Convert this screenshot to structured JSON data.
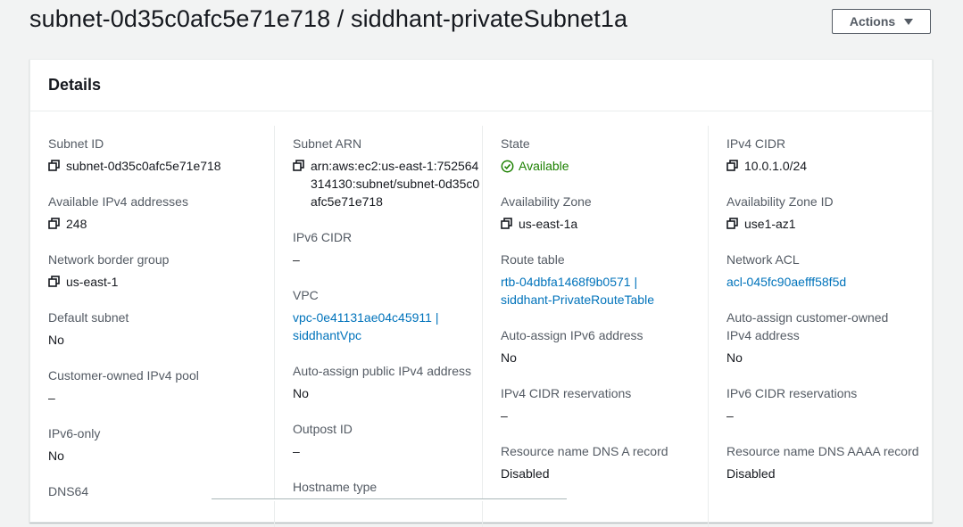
{
  "header": {
    "title": "subnet-0d35c0afc5e71e718 / siddhant-privateSubnet1a",
    "actions_label": "Actions"
  },
  "panel": {
    "title": "Details"
  },
  "col1": {
    "subnet_id": {
      "label": "Subnet ID",
      "value": "subnet-0d35c0afc5e71e718"
    },
    "available_ipv4": {
      "label": "Available IPv4 addresses",
      "value": "248"
    },
    "network_border_group": {
      "label": "Network border group",
      "value": "us-east-1"
    },
    "default_subnet": {
      "label": "Default subnet",
      "value": "No"
    },
    "customer_owned_pool": {
      "label": "Customer-owned IPv4 pool",
      "value": "–"
    },
    "ipv6_only": {
      "label": "IPv6-only",
      "value": "No"
    },
    "dns64": {
      "label": "DNS64"
    }
  },
  "col2": {
    "subnet_arn": {
      "label": "Subnet ARN",
      "value": "arn:aws:ec2:us-east-1:752564314130:subnet/subnet-0d35c0afc5e71e718"
    },
    "ipv6_cidr": {
      "label": "IPv6 CIDR",
      "value": "–"
    },
    "vpc": {
      "label": "VPC",
      "value": "vpc-0e41131ae04c45911 | siddhantVpc"
    },
    "auto_assign_public_ipv4": {
      "label": "Auto-assign public IPv4 address",
      "value": "No"
    },
    "outpost_id": {
      "label": "Outpost ID",
      "value": "–"
    },
    "hostname_type": {
      "label": "Hostname type"
    }
  },
  "col3": {
    "state": {
      "label": "State",
      "value": "Available"
    },
    "availability_zone": {
      "label": "Availability Zone",
      "value": "us-east-1a"
    },
    "route_table": {
      "label": "Route table",
      "value": "rtb-04dbfa1468f9b0571 | siddhant-PrivateRouteTable"
    },
    "auto_assign_ipv6": {
      "label": "Auto-assign IPv6 address",
      "value": "No"
    },
    "ipv4_cidr_reservations": {
      "label": "IPv4 CIDR reservations",
      "value": "–"
    },
    "dns_a_record": {
      "label": "Resource name DNS A record",
      "value": "Disabled"
    }
  },
  "col4": {
    "ipv4_cidr": {
      "label": "IPv4 CIDR",
      "value": "10.0.1.0/24"
    },
    "availability_zone_id": {
      "label": "Availability Zone ID",
      "value": "use1-az1"
    },
    "network_acl": {
      "label": "Network ACL",
      "value": "acl-045fc90aefff58f5d"
    },
    "auto_assign_customer_owned": {
      "label": "Auto-assign customer-owned IPv4 address",
      "value": "No"
    },
    "ipv6_cidr_reservations": {
      "label": "IPv6 CIDR reservations",
      "value": "–"
    },
    "dns_aaaa_record": {
      "label": "Resource name DNS AAAA record",
      "value": "Disabled"
    }
  },
  "colors": {
    "link": "#0073bb",
    "success": "#1d8102",
    "label": "#545b64"
  },
  "icons": {
    "copy": "copy-icon",
    "status": "status-check-icon",
    "actions": "caret-down-icon"
  }
}
